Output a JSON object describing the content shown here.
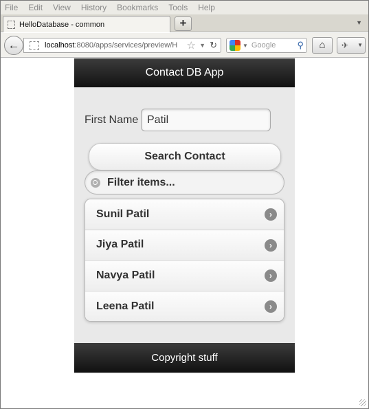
{
  "browser": {
    "menu": [
      "File",
      "Edit",
      "View",
      "History",
      "Bookmarks",
      "Tools",
      "Help"
    ],
    "tab_title": "HelloDatabase - common",
    "new_tab_label": "+",
    "url_host": "localhost",
    "url_path": ":8080/apps/services/preview/H",
    "search_placeholder": "Google"
  },
  "app": {
    "header_title": "Contact DB App",
    "first_name_label": "First Name",
    "first_name_value": "Patil",
    "search_button_label": "Search Contact",
    "filter_placeholder": "Filter items...",
    "contacts": [
      {
        "name": "Sunil Patil"
      },
      {
        "name": "Jiya Patil"
      },
      {
        "name": "Navya Patil"
      },
      {
        "name": "Leena Patil"
      }
    ],
    "footer_text": "Copyright stuff"
  }
}
